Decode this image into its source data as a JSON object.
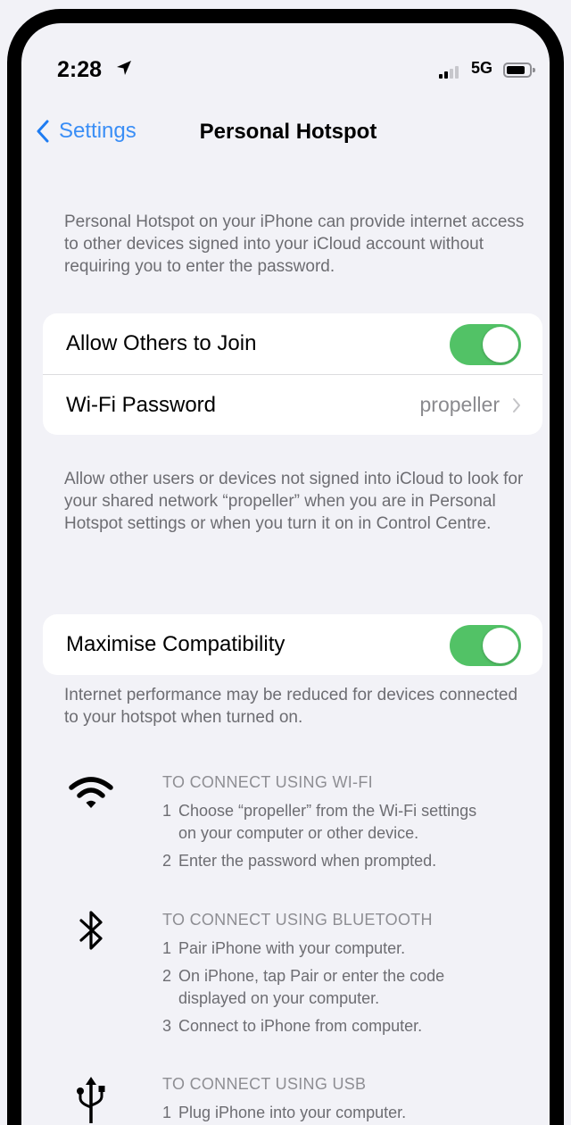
{
  "status_bar": {
    "time": "2:28",
    "network": "5G",
    "signal_bars_active": 2,
    "signal_bars_total": 4
  },
  "nav": {
    "back_label": "Settings",
    "title": "Personal Hotspot"
  },
  "intro_text": "Personal Hotspot on your iPhone can provide internet access to other devices signed into your iCloud account without requiring you to enter the password.",
  "group1": {
    "allow_others": {
      "label": "Allow Others to Join",
      "on": true
    },
    "wifi_password": {
      "label": "Wi-Fi Password",
      "value": "propeller"
    }
  },
  "group1_footer": "Allow other users or devices not signed into iCloud to look for your shared network “propeller” when you are in Personal Hotspot settings or when you turn it on in Control Centre.",
  "group2": {
    "maximise": {
      "label": "Maximise Compatibility",
      "on": true
    }
  },
  "group2_footer": "Internet performance may be reduced for devices connected to your hotspot when turned on.",
  "methods": [
    {
      "icon": "wifi-icon",
      "heading": "TO CONNECT USING WI-FI",
      "steps": [
        {
          "num": "1",
          "lines": [
            "Choose “propeller” from the Wi-Fi settings",
            "on your computer or other device."
          ]
        },
        {
          "num": "2",
          "lines": [
            "Enter the password when prompted."
          ]
        }
      ]
    },
    {
      "icon": "bluetooth-icon",
      "heading": "TO CONNECT USING BLUETOOTH",
      "steps": [
        {
          "num": "1",
          "lines": [
            "Pair iPhone with your computer."
          ]
        },
        {
          "num": "2",
          "lines": [
            "On iPhone, tap Pair or enter the code",
            "displayed on your computer."
          ]
        },
        {
          "num": "3",
          "lines": [
            "Connect to iPhone from computer."
          ]
        }
      ]
    },
    {
      "icon": "usb-icon",
      "heading": "TO CONNECT USING USB",
      "steps": [
        {
          "num": "1",
          "lines": [
            "Plug iPhone into your computer."
          ]
        }
      ]
    }
  ],
  "colors": {
    "accent": "#1e7cf2",
    "toggle_on": "#52c266",
    "background": "#f2f2f7",
    "secondary_text": "#6d6d72"
  }
}
